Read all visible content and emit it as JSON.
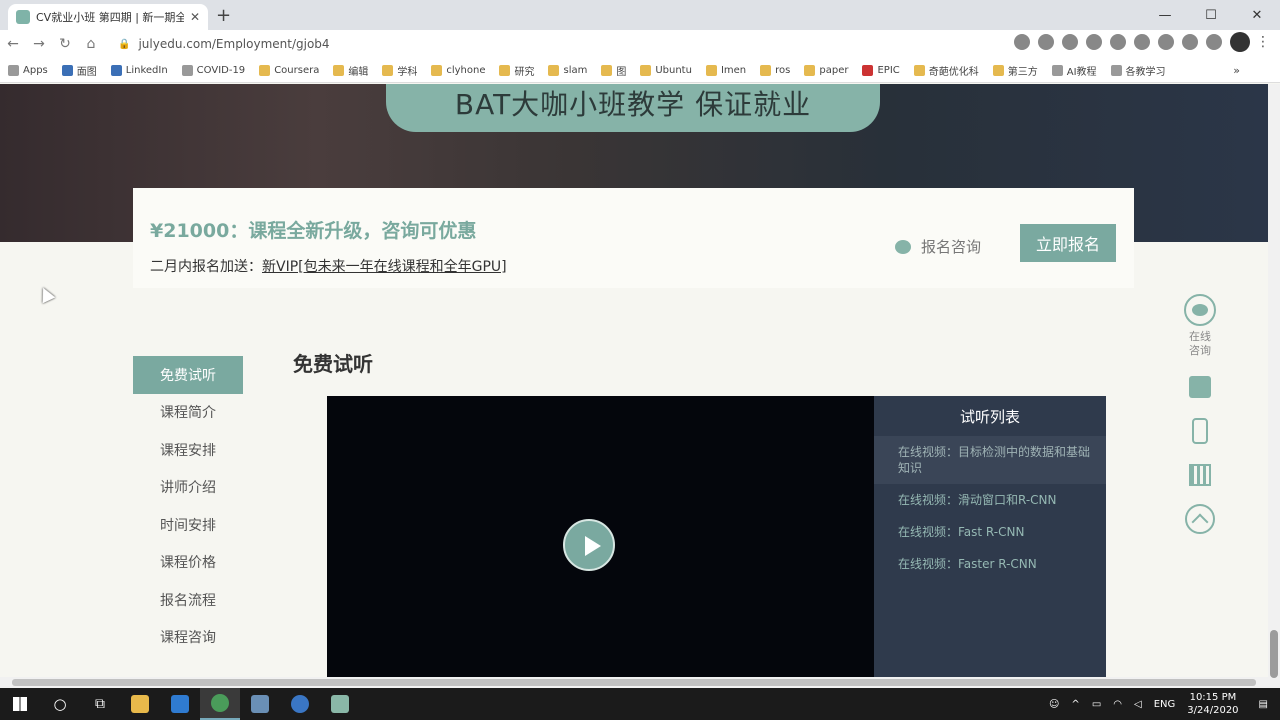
{
  "browser": {
    "tab_title": "CV就业小班 第四期 | 新一期全新",
    "url": "julyedu.com/Employment/gjob4",
    "bookmarks": [
      "Apps",
      "面图",
      "LinkedIn",
      "COVID-19",
      "Coursera",
      "编辑",
      "学科",
      "clyhone",
      "研究",
      "slam",
      "图",
      "Ubuntu",
      "Imen",
      "ros",
      "paper",
      "EPIC",
      "奇葩优化科",
      "第三方",
      "AI教程",
      "各教学习"
    ]
  },
  "hero": {
    "slogan": "BAT大咖小班教学  保证就业"
  },
  "pricebox": {
    "price": "¥21000：课程全新升级，咨询可优惠",
    "promo_prefix": "二月内报名加送：",
    "promo_link": "新VIP[包未来一年在线课程和全年GPU]",
    "consult_label": "报名咨询",
    "enroll_label": "立即报名"
  },
  "sidenav": [
    {
      "label": "免费试听",
      "active": true
    },
    {
      "label": "课程简介",
      "active": false
    },
    {
      "label": "课程安排",
      "active": false
    },
    {
      "label": "讲师介绍",
      "active": false
    },
    {
      "label": "时间安排",
      "active": false
    },
    {
      "label": "课程价格",
      "active": false
    },
    {
      "label": "报名流程",
      "active": false
    },
    {
      "label": "课程咨询",
      "active": false
    }
  ],
  "section_title": "免费试听",
  "playlist": {
    "title": "试听列表",
    "items": [
      {
        "label": "在线视频：目标检测中的数据和基础知识",
        "active": true
      },
      {
        "label": "在线视频：滑动窗口和R-CNN",
        "active": false
      },
      {
        "label": "在线视频：Fast R-CNN",
        "active": false
      },
      {
        "label": "在线视频：Faster R-CNN",
        "active": false
      }
    ]
  },
  "floatbar": {
    "chat_label_1": "在线",
    "chat_label_2": "咨询"
  },
  "taskbar": {
    "lang": "ENG",
    "time": "10:15 PM",
    "date": "3/24/2020"
  },
  "colors": {
    "accent": "#7aa9a0",
    "price": "#79a99e",
    "playlist_bg": "#2f3a4c"
  }
}
